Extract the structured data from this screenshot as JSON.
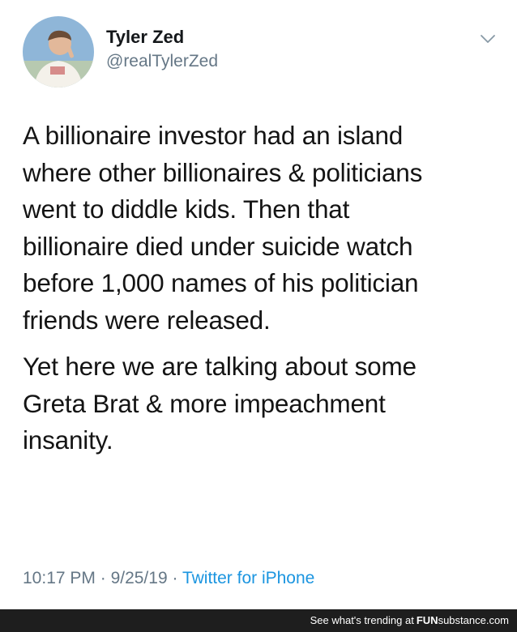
{
  "tweet": {
    "author": {
      "display_name": "Tyler Zed",
      "handle": "@realTylerZed",
      "avatar_icon": "profile-photo"
    },
    "menu_icon": "chevron-down-icon",
    "paragraphs": [
      {
        "lines": [
          "A billionaire investor had an island",
          "where other billionaires & politicians",
          "went to diddle kids. Then that",
          "billionaire died under suicide watch",
          "before 1,000 names of his politician",
          "friends were released."
        ]
      },
      {
        "lines": [
          "Yet here we are talking about some",
          "Greta Brat & more impeachment",
          "insanity."
        ]
      }
    ],
    "meta": {
      "time": "10:17 PM",
      "separator_1": " · ",
      "date": "9/25/19",
      "separator_2": " · ",
      "source": "Twitter for iPhone"
    }
  },
  "footer": {
    "prefix": "See what's trending at",
    "brand_part1": "FUN",
    "brand_part2": "substance",
    "brand_part3": ".com"
  },
  "colors": {
    "handle_gray": "#657786",
    "link_blue": "#1b95e0",
    "footer_bg": "#1e1e1e"
  }
}
